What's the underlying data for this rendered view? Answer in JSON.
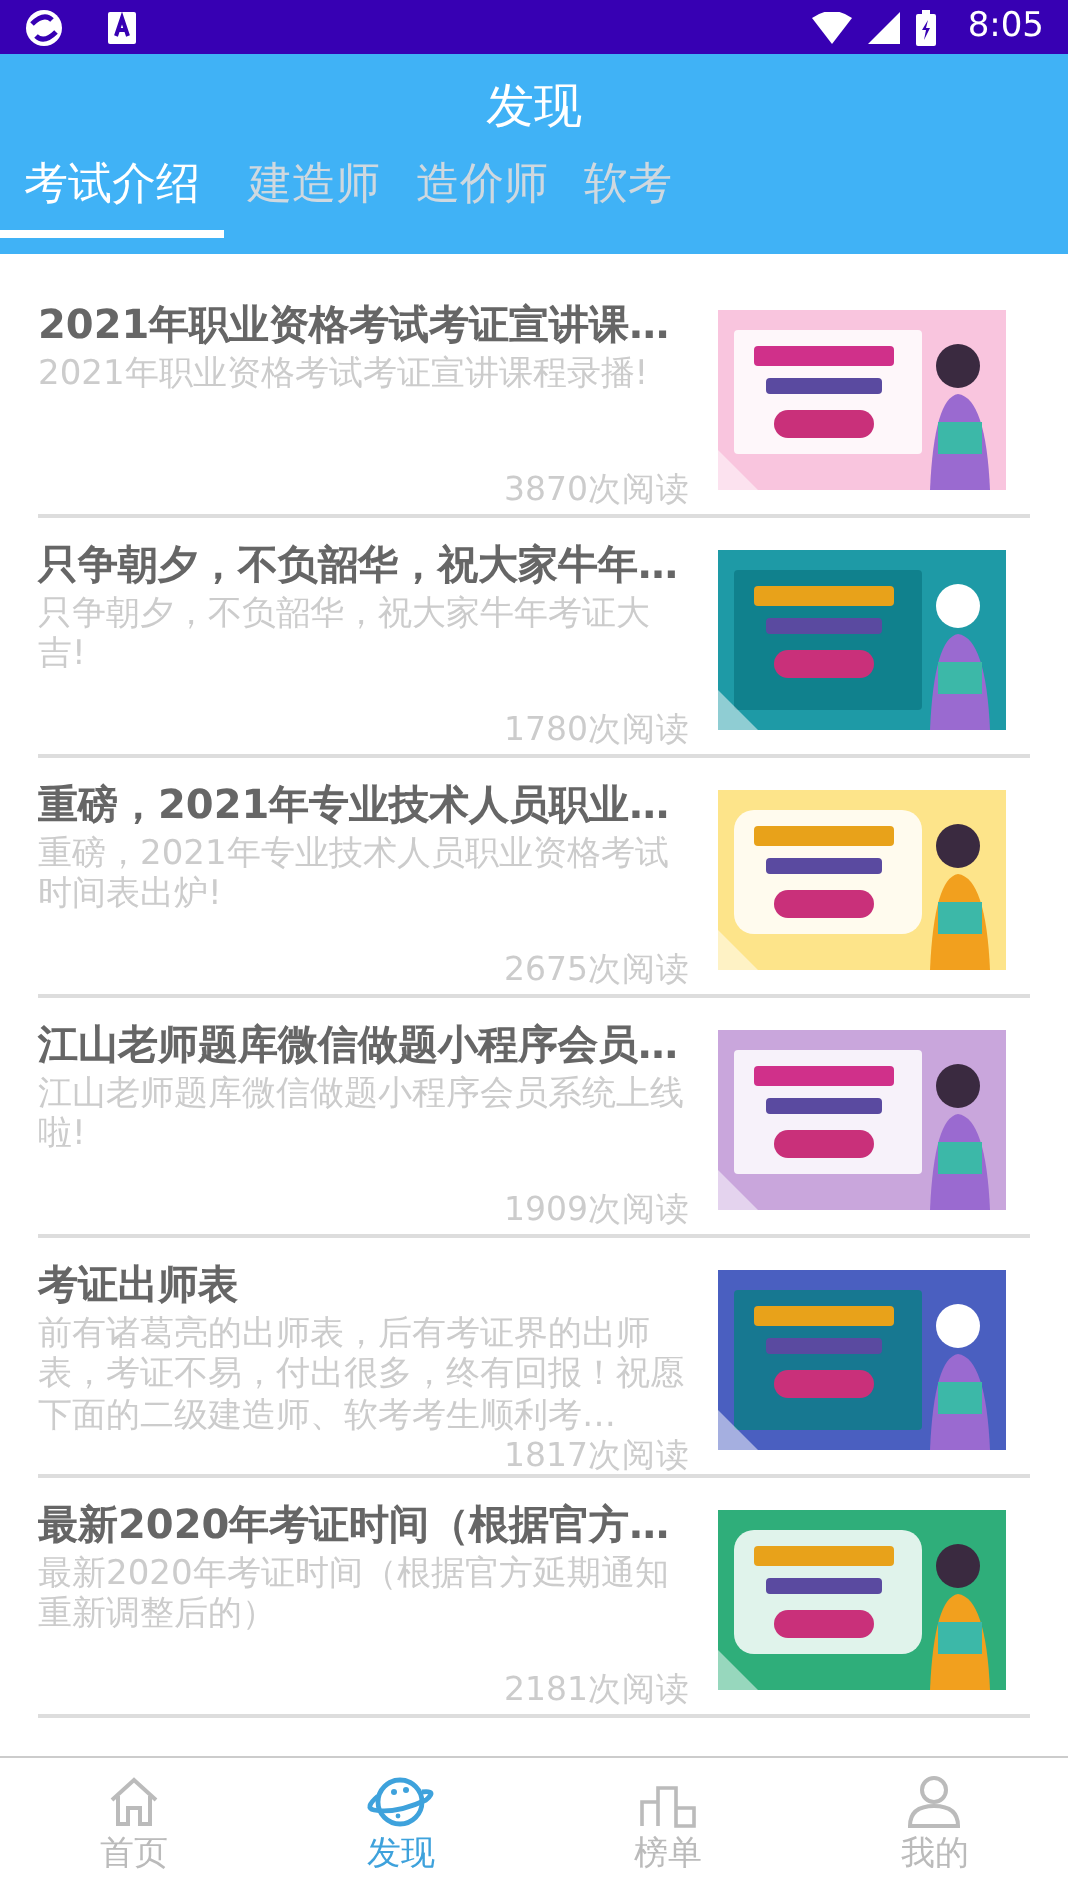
{
  "status_bar": {
    "time": "8:05"
  },
  "header": {
    "title": "发现"
  },
  "tabs": [
    {
      "label": "考试介绍",
      "selected": true
    },
    {
      "label": "建造师",
      "selected": false
    },
    {
      "label": "造价师",
      "selected": false
    },
    {
      "label": "软考",
      "selected": false
    }
  ],
  "articles": [
    {
      "title": "2021年职业资格考试考证宣讲课…",
      "summary": "2021年职业资格考试考证宣讲课程录播!",
      "reads": "3870次阅读"
    },
    {
      "title": "只争朝夕，不负韶华，祝大家牛年…",
      "summary": "只争朝夕，不负韶华，祝大家牛年考证大吉!",
      "reads": "1780次阅读"
    },
    {
      "title": "重磅，2021年专业技术人员职业…",
      "summary": "重磅，2021年专业技术人员职业资格考试时间表出炉!",
      "reads": "2675次阅读"
    },
    {
      "title": "江山老师题库微信做题小程序会员…",
      "summary": "江山老师题库微信做题小程序会员系统上线啦!",
      "reads": "1909次阅读"
    },
    {
      "title": "考证出师表",
      "summary": "前有诸葛亮的出师表，后有考证界的出师表，考证不易，付出很多，终有回报！祝愿下面的二级建造师、软考考生顺利考…",
      "reads": "1817次阅读"
    },
    {
      "title": "最新2020年考证时间（根据官方…",
      "summary": "最新2020年考证时间（根据官方延期通知重新调整后的）",
      "reads": "2181次阅读"
    }
  ],
  "bottom_nav": [
    {
      "label": "首页",
      "selected": false
    },
    {
      "label": "发现",
      "selected": true
    },
    {
      "label": "榜单",
      "selected": false
    },
    {
      "label": "我的",
      "selected": false
    }
  ]
}
